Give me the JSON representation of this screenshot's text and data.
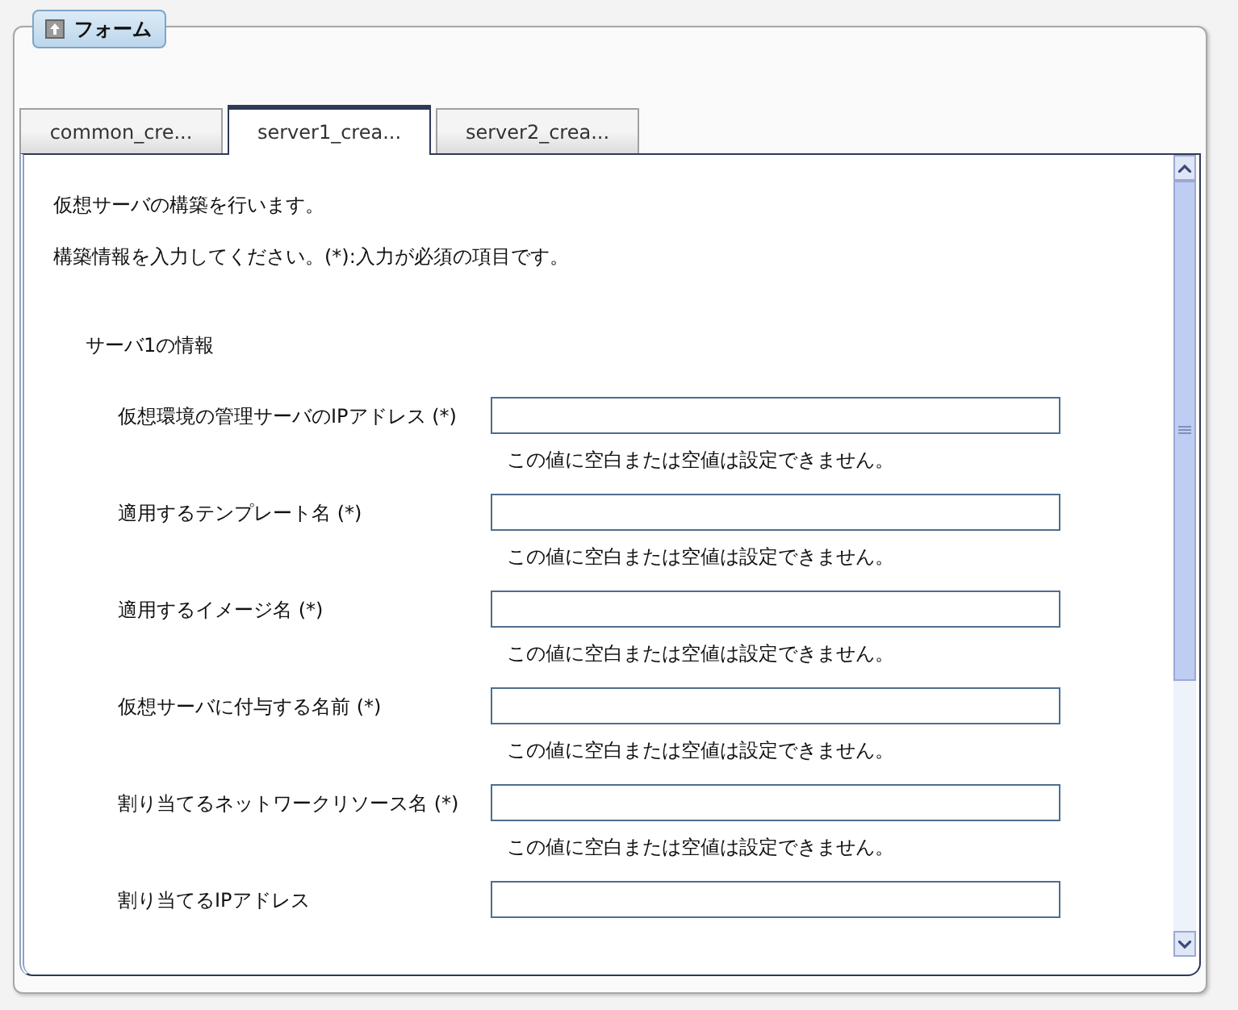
{
  "panel": {
    "title": "フォーム"
  },
  "tabs": [
    {
      "label": "common_cre...",
      "selected": false
    },
    {
      "label": "server1_crea...",
      "selected": true
    },
    {
      "label": "server2_crea...",
      "selected": false
    }
  ],
  "intro": [
    "仮想サーバの構築を行います。",
    "構築情報を入力してください。(*):入力が必須の項目です。"
  ],
  "section": {
    "title": "サーバ1の情報",
    "fields": [
      {
        "label": "仮想環境の管理サーバのIPアドレス (*)",
        "error": "この値に空白または空値は設定できません。"
      },
      {
        "label": "適用するテンプレート名 (*)",
        "error": "この値に空白または空値は設定できません。"
      },
      {
        "label": "適用するイメージ名 (*)",
        "error": "この値に空白または空値は設定できません。"
      },
      {
        "label": "仮想サーバに付与する名前 (*)",
        "error": "この値に空白または空値は設定できません。"
      },
      {
        "label": "割り当てるネットワークリソース名 (*)",
        "error": "この値に空白または空値は設定できません。"
      },
      {
        "label": "割り当てるIPアドレス"
      }
    ]
  }
}
